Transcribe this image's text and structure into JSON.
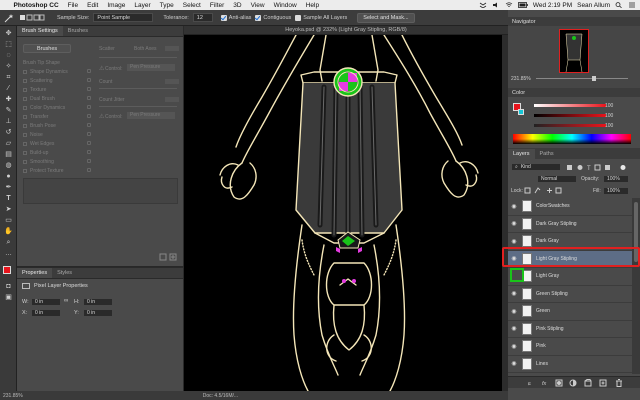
{
  "menubar": {
    "apple": "",
    "app": "Photoshop CC",
    "items": [
      "File",
      "Edit",
      "Image",
      "Layer",
      "Type",
      "Select",
      "Filter",
      "3D",
      "View",
      "Window",
      "Help"
    ],
    "clock": "Wed 2:19 PM",
    "user": "Sean Allum"
  },
  "options": {
    "sample_size_label": "Sample Size:",
    "sample_size_value": "Point Sample",
    "tolerance_label": "Tolerance:",
    "tolerance_value": "12",
    "anti_alias": "Anti-alias",
    "contiguous": "Contiguous",
    "sample_all_layers": "Sample All Layers",
    "select_mask": "Select and Mask..."
  },
  "brush_panel": {
    "tabs": [
      "Brush Settings",
      "Brushes"
    ],
    "brushes_button": "Brushes",
    "scatter": "Scatter",
    "both_axes": "Both Axes",
    "control_label": "Control:",
    "pen_pressure": "Pen Pressure",
    "count": "Count",
    "count_jitter": "Count Jitter",
    "rows": [
      "Brush Tip Shape",
      "Shape Dynamics",
      "Scattering",
      "Texture",
      "Dual Brush",
      "Color Dynamics",
      "Transfer",
      "Brush Pose",
      "Noise",
      "Wet Edges",
      "Build-up",
      "Smoothing",
      "Protect Texture"
    ]
  },
  "properties": {
    "tabs": [
      "Properties",
      "Styles"
    ],
    "title": "Pixel Layer Properties",
    "w_label": "W:",
    "w_value": "0 in",
    "h_label": "H:",
    "h_value": "0 in",
    "x_label": "X:",
    "x_value": "0 in",
    "y_label": "Y:",
    "y_value": "0 in"
  },
  "document": {
    "tab_title": "Heyoka.psd @ 232% (Light Gray Stipling, RGB/8)",
    "zoom_status": "231.85%",
    "doc_status": "Doc: 4.5/16M/..."
  },
  "navigator": {
    "title": "Navigator",
    "zoom": "231.85%"
  },
  "color": {
    "title": "Color",
    "values": [
      "100",
      "100",
      "100"
    ]
  },
  "layers": {
    "tabs": [
      "Layers",
      "Paths"
    ],
    "kind": "Kind",
    "blend": "Normal",
    "opacity_label": "Opacity:",
    "opacity_value": "100%",
    "lock_label": "Lock:",
    "fill_label": "Fill:",
    "fill_value": "100%",
    "items": [
      {
        "name": "ColorSwatches"
      },
      {
        "name": "Dark Gray Stipling"
      },
      {
        "name": "Dark Gray"
      },
      {
        "name": "Light Gray Stipling"
      },
      {
        "name": "Light Gray"
      },
      {
        "name": "Green Stipling"
      },
      {
        "name": "Green"
      },
      {
        "name": "Pink Stipling"
      },
      {
        "name": "Pink"
      },
      {
        "name": "Lines"
      }
    ]
  },
  "colors": {
    "highlight": "#e02020",
    "foreground": "#e8141c",
    "background": "#15c6d6",
    "green_swatch": "#19c419",
    "line_art": "#f4e6b8"
  }
}
